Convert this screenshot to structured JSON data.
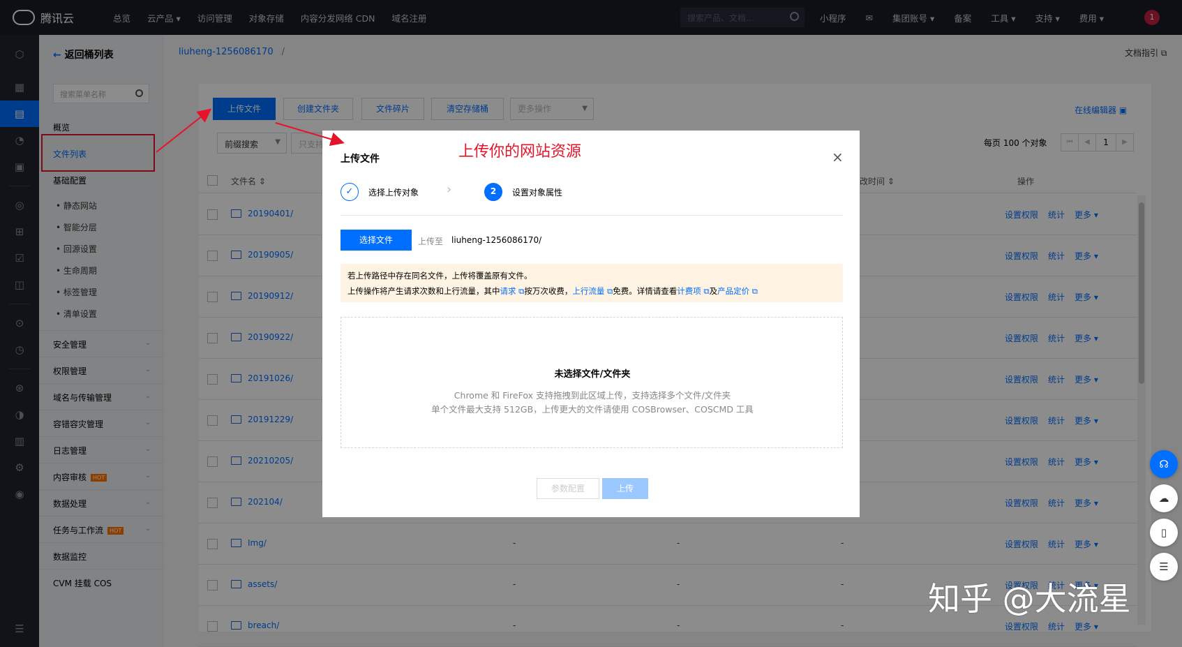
{
  "topbar": {
    "brand": "腾讯云",
    "nav": [
      "总览",
      "云产品 ▾",
      "访问管理",
      "对象存储",
      "内容分发网络 CDN",
      "域名注册"
    ],
    "search_placeholder": "搜索产品、文档...",
    "right": [
      "小程序",
      "✉",
      "集团账号 ▾",
      "备案",
      "工具 ▾",
      "支持 ▾",
      "费用 ▾"
    ],
    "avatar_badge": "1"
  },
  "subnav": {
    "back": "返回桶列表",
    "search_placeholder": "搜索菜单名称",
    "overview": "概览",
    "file_list": "文件列表",
    "basic_config": "基础配置",
    "basic_items": [
      "静态网站",
      "智能分层",
      "回源设置",
      "生命周期",
      "标签管理",
      "清单设置"
    ],
    "groups": [
      "安全管理",
      "权限管理",
      "域名与传输管理",
      "容错容灾管理",
      "日志管理",
      "内容审核",
      "数据处理",
      "任务与工作流",
      "数据监控",
      "CVM 挂载 COS"
    ],
    "hot": "HOT"
  },
  "breadcrumb": {
    "bucket": "liuheng-1256086170",
    "sep": "/"
  },
  "doc_guide": "文档指引 ⧉",
  "toolbar": {
    "upload": "上传文件",
    "create_folder": "创建文件夹",
    "fragments": "文件碎片",
    "clear_bucket": "清空存储桶",
    "more_ops": "更多操作",
    "online_editor": "在线编辑器 ▣"
  },
  "filter": {
    "prefix_search": "前缀搜索",
    "hint": "只支持"
  },
  "pagination": {
    "per_page": "每页 100 个对象",
    "page": "1"
  },
  "table": {
    "col_name": "文件名 ⇕",
    "col_time": "修改时间 ⇕",
    "col_ops": "操作",
    "actions": [
      "设置权限",
      "统计",
      "更多 ▾"
    ],
    "dash": "-",
    "rows": [
      "20190401/",
      "20190905/",
      "20190912/",
      "20190922/",
      "20191026/",
      "20191229/",
      "20210205/",
      "202104/",
      "Img/",
      "assets/",
      "breach/"
    ]
  },
  "modal": {
    "title": "上传文件",
    "annotation": "上传你的网站资源",
    "close": "×",
    "step1": "选择上传对象",
    "step2_num": "2",
    "step2": "设置对象属性",
    "choose_file": "选择文件",
    "upload_to": "上传至",
    "upload_path": "liuheng-1256086170/",
    "warn_line1": "若上传路径中存在同名文件，上传将覆盖原有文件。",
    "warn_a": "上传操作将产生请求次数和上行流量，其中",
    "warn_link1": "请求 ⧉",
    "warn_b": "按万次收费，",
    "warn_link2": "上行流量 ⧉",
    "warn_c": "免费。详情请查看",
    "warn_link3": "计费项 ⧉",
    "warn_d": "及",
    "warn_link4": "产品定价 ⧉",
    "drop_title": "未选择文件/文件夹",
    "drop_line1": "Chrome 和 FireFox 支持拖拽到此区域上传，支持选择多个文件/文件夹",
    "drop_line2": "单个文件最大支持 512GB，上传更大的文件请使用 COSBrowser、COSCMD 工具",
    "btn_params": "参数配置",
    "btn_upload": "上传"
  },
  "watermark": "知乎 @大流星"
}
